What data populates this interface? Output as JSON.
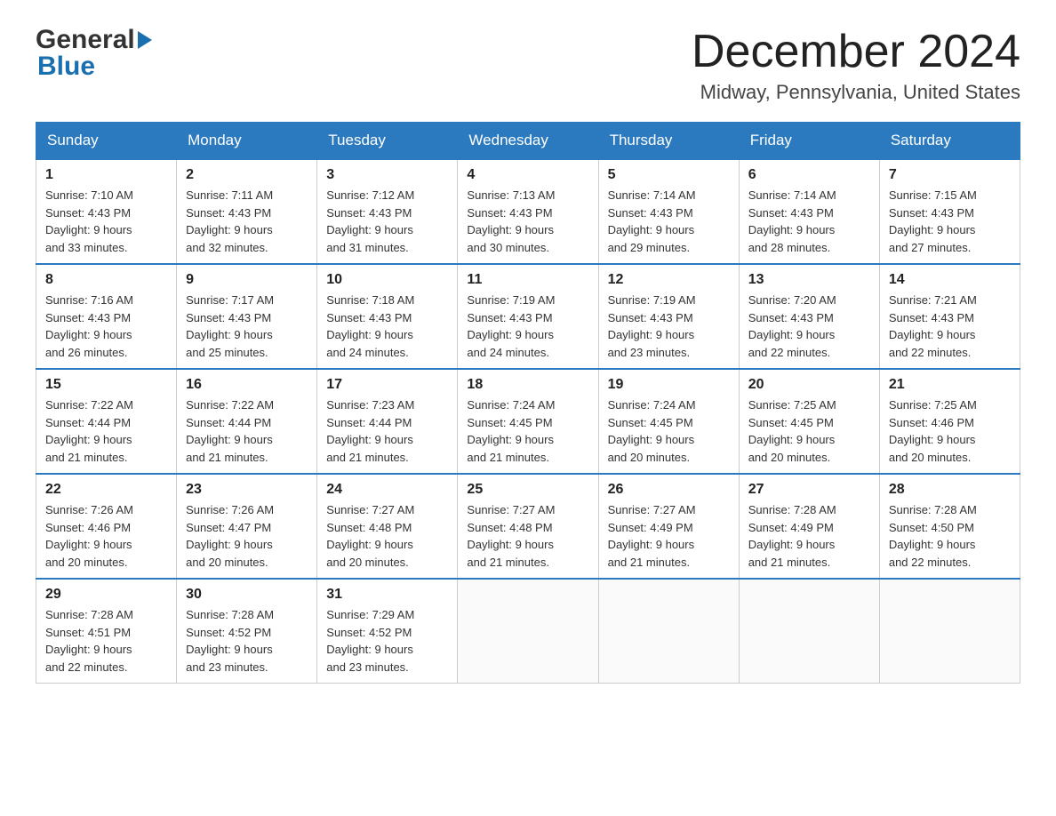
{
  "header": {
    "logo_text1": "General",
    "logo_text2": "Blue",
    "month_title": "December 2024",
    "location": "Midway, Pennsylvania, United States"
  },
  "weekdays": [
    "Sunday",
    "Monday",
    "Tuesday",
    "Wednesday",
    "Thursday",
    "Friday",
    "Saturday"
  ],
  "weeks": [
    [
      {
        "day": "1",
        "sunrise": "7:10 AM",
        "sunset": "4:43 PM",
        "daylight": "9 hours and 33 minutes."
      },
      {
        "day": "2",
        "sunrise": "7:11 AM",
        "sunset": "4:43 PM",
        "daylight": "9 hours and 32 minutes."
      },
      {
        "day": "3",
        "sunrise": "7:12 AM",
        "sunset": "4:43 PM",
        "daylight": "9 hours and 31 minutes."
      },
      {
        "day": "4",
        "sunrise": "7:13 AM",
        "sunset": "4:43 PM",
        "daylight": "9 hours and 30 minutes."
      },
      {
        "day": "5",
        "sunrise": "7:14 AM",
        "sunset": "4:43 PM",
        "daylight": "9 hours and 29 minutes."
      },
      {
        "day": "6",
        "sunrise": "7:14 AM",
        "sunset": "4:43 PM",
        "daylight": "9 hours and 28 minutes."
      },
      {
        "day": "7",
        "sunrise": "7:15 AM",
        "sunset": "4:43 PM",
        "daylight": "9 hours and 27 minutes."
      }
    ],
    [
      {
        "day": "8",
        "sunrise": "7:16 AM",
        "sunset": "4:43 PM",
        "daylight": "9 hours and 26 minutes."
      },
      {
        "day": "9",
        "sunrise": "7:17 AM",
        "sunset": "4:43 PM",
        "daylight": "9 hours and 25 minutes."
      },
      {
        "day": "10",
        "sunrise": "7:18 AM",
        "sunset": "4:43 PM",
        "daylight": "9 hours and 24 minutes."
      },
      {
        "day": "11",
        "sunrise": "7:19 AM",
        "sunset": "4:43 PM",
        "daylight": "9 hours and 24 minutes."
      },
      {
        "day": "12",
        "sunrise": "7:19 AM",
        "sunset": "4:43 PM",
        "daylight": "9 hours and 23 minutes."
      },
      {
        "day": "13",
        "sunrise": "7:20 AM",
        "sunset": "4:43 PM",
        "daylight": "9 hours and 22 minutes."
      },
      {
        "day": "14",
        "sunrise": "7:21 AM",
        "sunset": "4:43 PM",
        "daylight": "9 hours and 22 minutes."
      }
    ],
    [
      {
        "day": "15",
        "sunrise": "7:22 AM",
        "sunset": "4:44 PM",
        "daylight": "9 hours and 21 minutes."
      },
      {
        "day": "16",
        "sunrise": "7:22 AM",
        "sunset": "4:44 PM",
        "daylight": "9 hours and 21 minutes."
      },
      {
        "day": "17",
        "sunrise": "7:23 AM",
        "sunset": "4:44 PM",
        "daylight": "9 hours and 21 minutes."
      },
      {
        "day": "18",
        "sunrise": "7:24 AM",
        "sunset": "4:45 PM",
        "daylight": "9 hours and 21 minutes."
      },
      {
        "day": "19",
        "sunrise": "7:24 AM",
        "sunset": "4:45 PM",
        "daylight": "9 hours and 20 minutes."
      },
      {
        "day": "20",
        "sunrise": "7:25 AM",
        "sunset": "4:45 PM",
        "daylight": "9 hours and 20 minutes."
      },
      {
        "day": "21",
        "sunrise": "7:25 AM",
        "sunset": "4:46 PM",
        "daylight": "9 hours and 20 minutes."
      }
    ],
    [
      {
        "day": "22",
        "sunrise": "7:26 AM",
        "sunset": "4:46 PM",
        "daylight": "9 hours and 20 minutes."
      },
      {
        "day": "23",
        "sunrise": "7:26 AM",
        "sunset": "4:47 PM",
        "daylight": "9 hours and 20 minutes."
      },
      {
        "day": "24",
        "sunrise": "7:27 AM",
        "sunset": "4:48 PM",
        "daylight": "9 hours and 20 minutes."
      },
      {
        "day": "25",
        "sunrise": "7:27 AM",
        "sunset": "4:48 PM",
        "daylight": "9 hours and 21 minutes."
      },
      {
        "day": "26",
        "sunrise": "7:27 AM",
        "sunset": "4:49 PM",
        "daylight": "9 hours and 21 minutes."
      },
      {
        "day": "27",
        "sunrise": "7:28 AM",
        "sunset": "4:49 PM",
        "daylight": "9 hours and 21 minutes."
      },
      {
        "day": "28",
        "sunrise": "7:28 AM",
        "sunset": "4:50 PM",
        "daylight": "9 hours and 22 minutes."
      }
    ],
    [
      {
        "day": "29",
        "sunrise": "7:28 AM",
        "sunset": "4:51 PM",
        "daylight": "9 hours and 22 minutes."
      },
      {
        "day": "30",
        "sunrise": "7:28 AM",
        "sunset": "4:52 PM",
        "daylight": "9 hours and 23 minutes."
      },
      {
        "day": "31",
        "sunrise": "7:29 AM",
        "sunset": "4:52 PM",
        "daylight": "9 hours and 23 minutes."
      },
      null,
      null,
      null,
      null
    ]
  ],
  "labels": {
    "sunrise": "Sunrise: ",
    "sunset": "Sunset: ",
    "daylight": "Daylight: "
  }
}
